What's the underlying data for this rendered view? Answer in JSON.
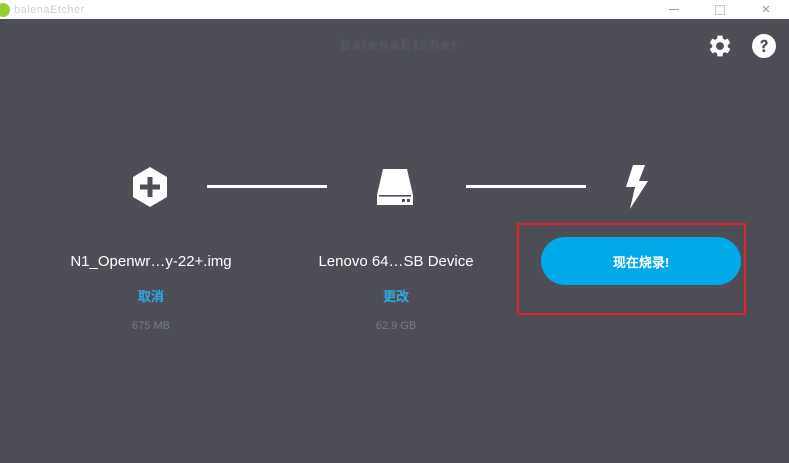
{
  "window": {
    "title": "balenaEtcher",
    "minimize_glyph": "",
    "maximize_glyph": "",
    "close_glyph": "✕"
  },
  "logo": {
    "text": "balenaEtcher"
  },
  "toolbar": {
    "settings_icon": "gear-icon",
    "help_icon": "help-icon"
  },
  "steps": [
    {
      "icon": "plus-hexagon-icon",
      "label": "N1_Openwr…y-22+.img",
      "action": "取消",
      "size": "675 MB"
    },
    {
      "icon": "drive-icon",
      "label": "Lenovo 64…SB Device",
      "action": "更改",
      "size": "62.9 GB"
    },
    {
      "icon": "lightning-icon",
      "button_label": "现在烧录!"
    }
  ],
  "colors": {
    "background": "#4d4e56",
    "accent": "#01a9e8",
    "link": "#2fa9e0",
    "highlight": "#e0262c"
  }
}
